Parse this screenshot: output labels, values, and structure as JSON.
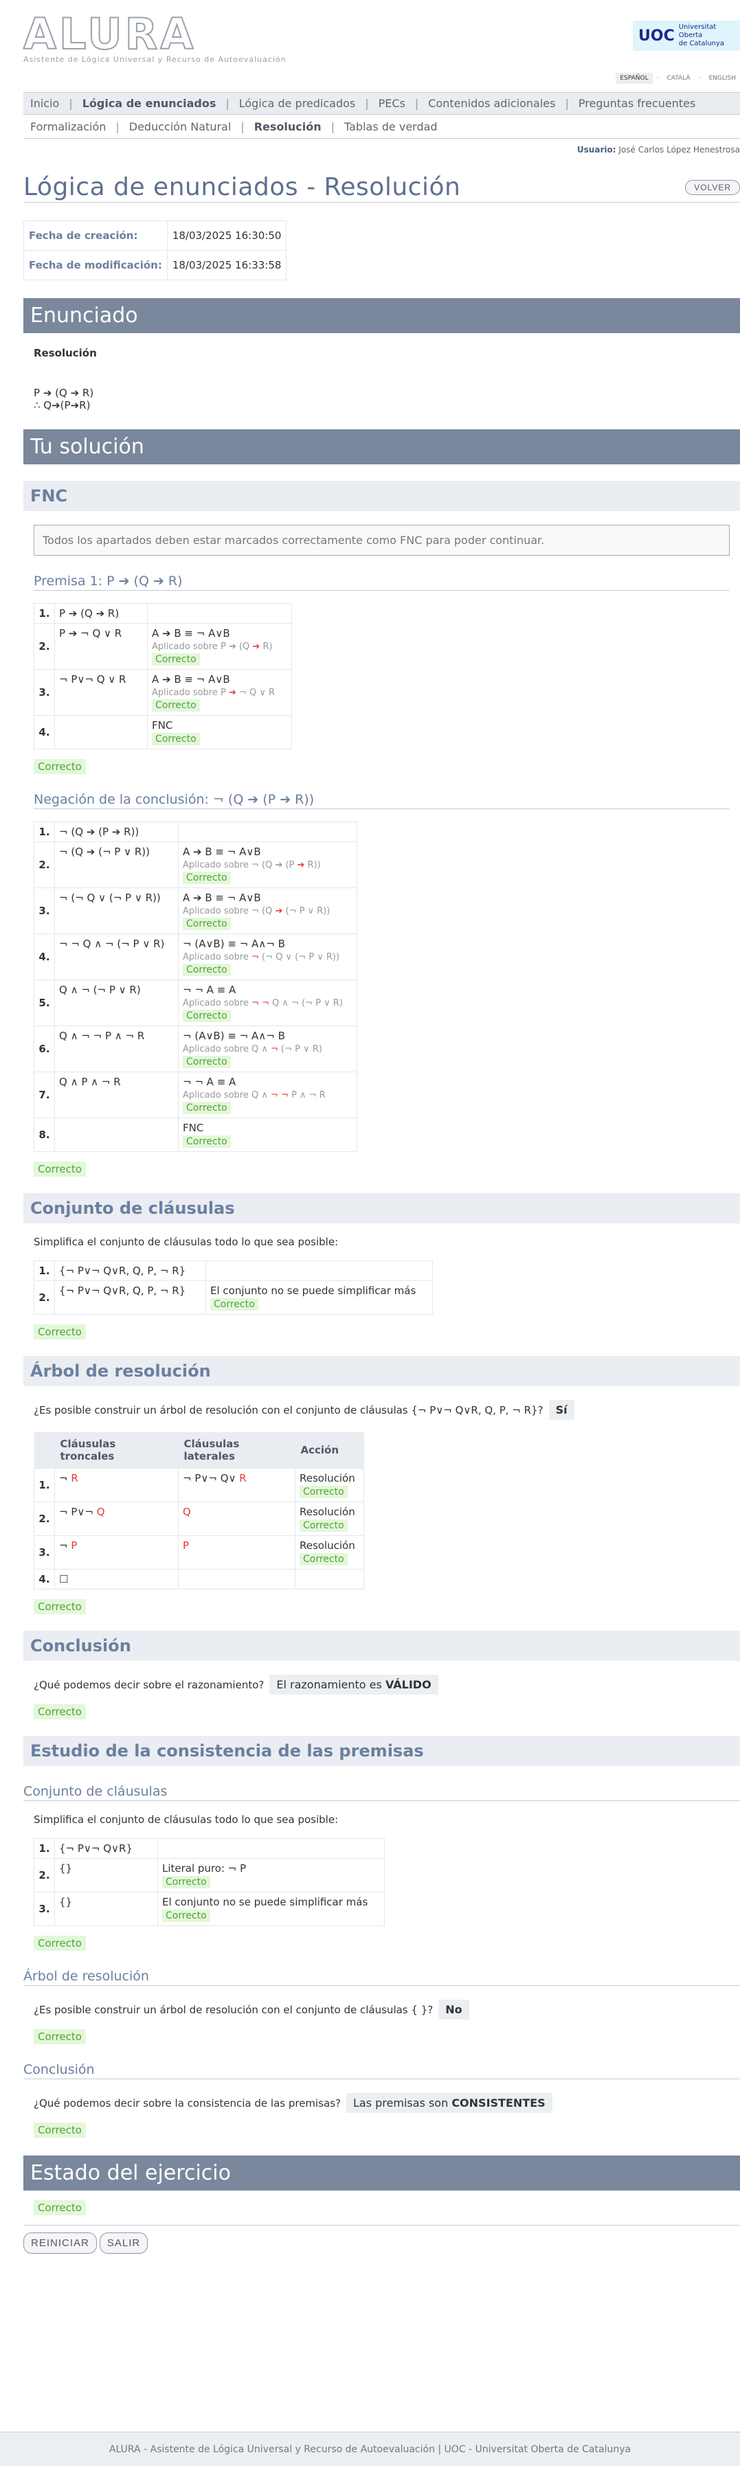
{
  "header": {
    "logo": "ALURA",
    "subtitle": "Asistente de Lógica Universal y Recurso de Autoevaluación",
    "uoc_mark": "UOC",
    "uoc_text1": "Universitat Oberta",
    "uoc_text2": "de Catalunya",
    "langs": [
      "ESPAÑOL",
      "CATALÀ",
      "ENGLISH"
    ]
  },
  "nav1": [
    "Inicio",
    "Lógica de enunciados",
    "Lógica de predicados",
    "PECs",
    "Contenidos adicionales",
    "Preguntas frecuentes"
  ],
  "nav2": [
    "Formalización",
    "Deducción Natural",
    "Resolución",
    "Tablas de verdad"
  ],
  "user": {
    "label": "Usuario:",
    "name": "José Carlos López Henestrosa"
  },
  "title": "Lógica de enunciados - Resolución",
  "back": "VOLVER",
  "meta": {
    "created_label": "Fecha de creación:",
    "created": "18/03/2025 16:30:50",
    "modified_label": "Fecha de modificación:",
    "modified": "18/03/2025 16:33:58"
  },
  "enunciado": {
    "banner": "Enunciado",
    "label": "Resolución",
    "line1": "P ➔ (Q ➔ R)",
    "line2": "∴ Q➔(P➔R)"
  },
  "solucion": "Tu solución",
  "fnc": {
    "title": "FNC",
    "msg": "Todos los apartados deben estar marcados correctamente como FNC para poder continuar.",
    "premisa_title": "Premisa 1: P ➔ (Q ➔ R)",
    "negacion_title": "Negación de la conclusión: ¬ (Q ➔ (P ➔ R))"
  },
  "ok": "Correcto",
  "conjunto": {
    "title": "Conjunto de cláusulas",
    "instr": "Simplifica el conjunto de cláusulas todo lo que sea posible:",
    "row1": "{¬ P∨¬ Q∨R, Q, P, ¬ R}",
    "row2": "{¬ P∨¬ Q∨R, Q, P, ¬ R}",
    "nosimp": "El conjunto no se puede simplificar más"
  },
  "arbol": {
    "title": "Árbol de resolución",
    "q": "¿Es posible construir un árbol de resolución con el conjunto de cláusulas {¬ P∨¬ Q∨R, Q, P, ¬ R}?",
    "a": "Sí",
    "cols": [
      "Cláusulas troncales",
      "Cláusulas laterales",
      "Acción"
    ],
    "res": "Resolución"
  },
  "conclusion": {
    "title": "Conclusión",
    "q": "¿Qué podemos decir sobre el razonamiento?",
    "a1": "El razonamiento es ",
    "a2": "VÁLIDO"
  },
  "consist": {
    "title": "Estudio de la consistencia de las premisas",
    "conj_title": "Conjunto de cláusulas",
    "instr": "Simplifica el conjunto de cláusulas todo lo que sea posible:",
    "r1": "{¬ P∨¬ Q∨R}",
    "r2": "{}",
    "r3": "{}",
    "lit": "Literal puro: ¬ P",
    "nosimp": "El conjunto no se puede simplificar más",
    "arbol_title": "Árbol de resolución",
    "q": "¿Es posible construir un árbol de resolución con el conjunto de cláusulas { }?",
    "a": "No",
    "concl_title": "Conclusión",
    "q2": "¿Qué podemos decir sobre la consistencia de las premisas?",
    "a2a": "Las premisas son ",
    "a2b": "CONSISTENTES"
  },
  "estado": {
    "banner": "Estado del ejercicio"
  },
  "actions": [
    "REINICIAR",
    "SALIR"
  ],
  "footer": "ALURA - Asistente de Lógica Universal y Recurso de Autoevaluación | UOC - Universitat Oberta de Catalunya"
}
